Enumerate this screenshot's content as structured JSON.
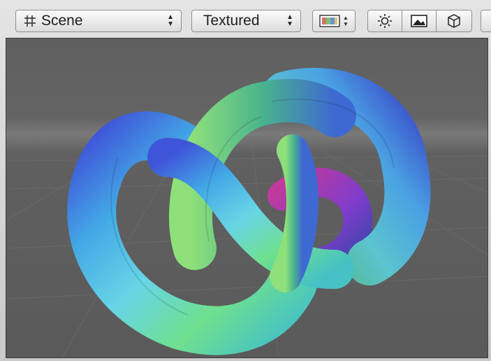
{
  "toolbar": {
    "view_dropdown": {
      "label": "Scene",
      "icon": "grid-icon"
    },
    "render_dropdown": {
      "label": "Textured"
    },
    "color_mode": {
      "icon": "color-swatch-icon"
    },
    "lighting": {
      "icon": "sun-icon"
    },
    "image": {
      "icon": "image-icon"
    },
    "object": {
      "icon": "cube-icon"
    }
  },
  "viewport": {
    "background_color": "#5e5e5e",
    "horizon_color": "#7a7a7a",
    "grid_color": "#6c6c6c",
    "object": "trefoil-knot"
  }
}
